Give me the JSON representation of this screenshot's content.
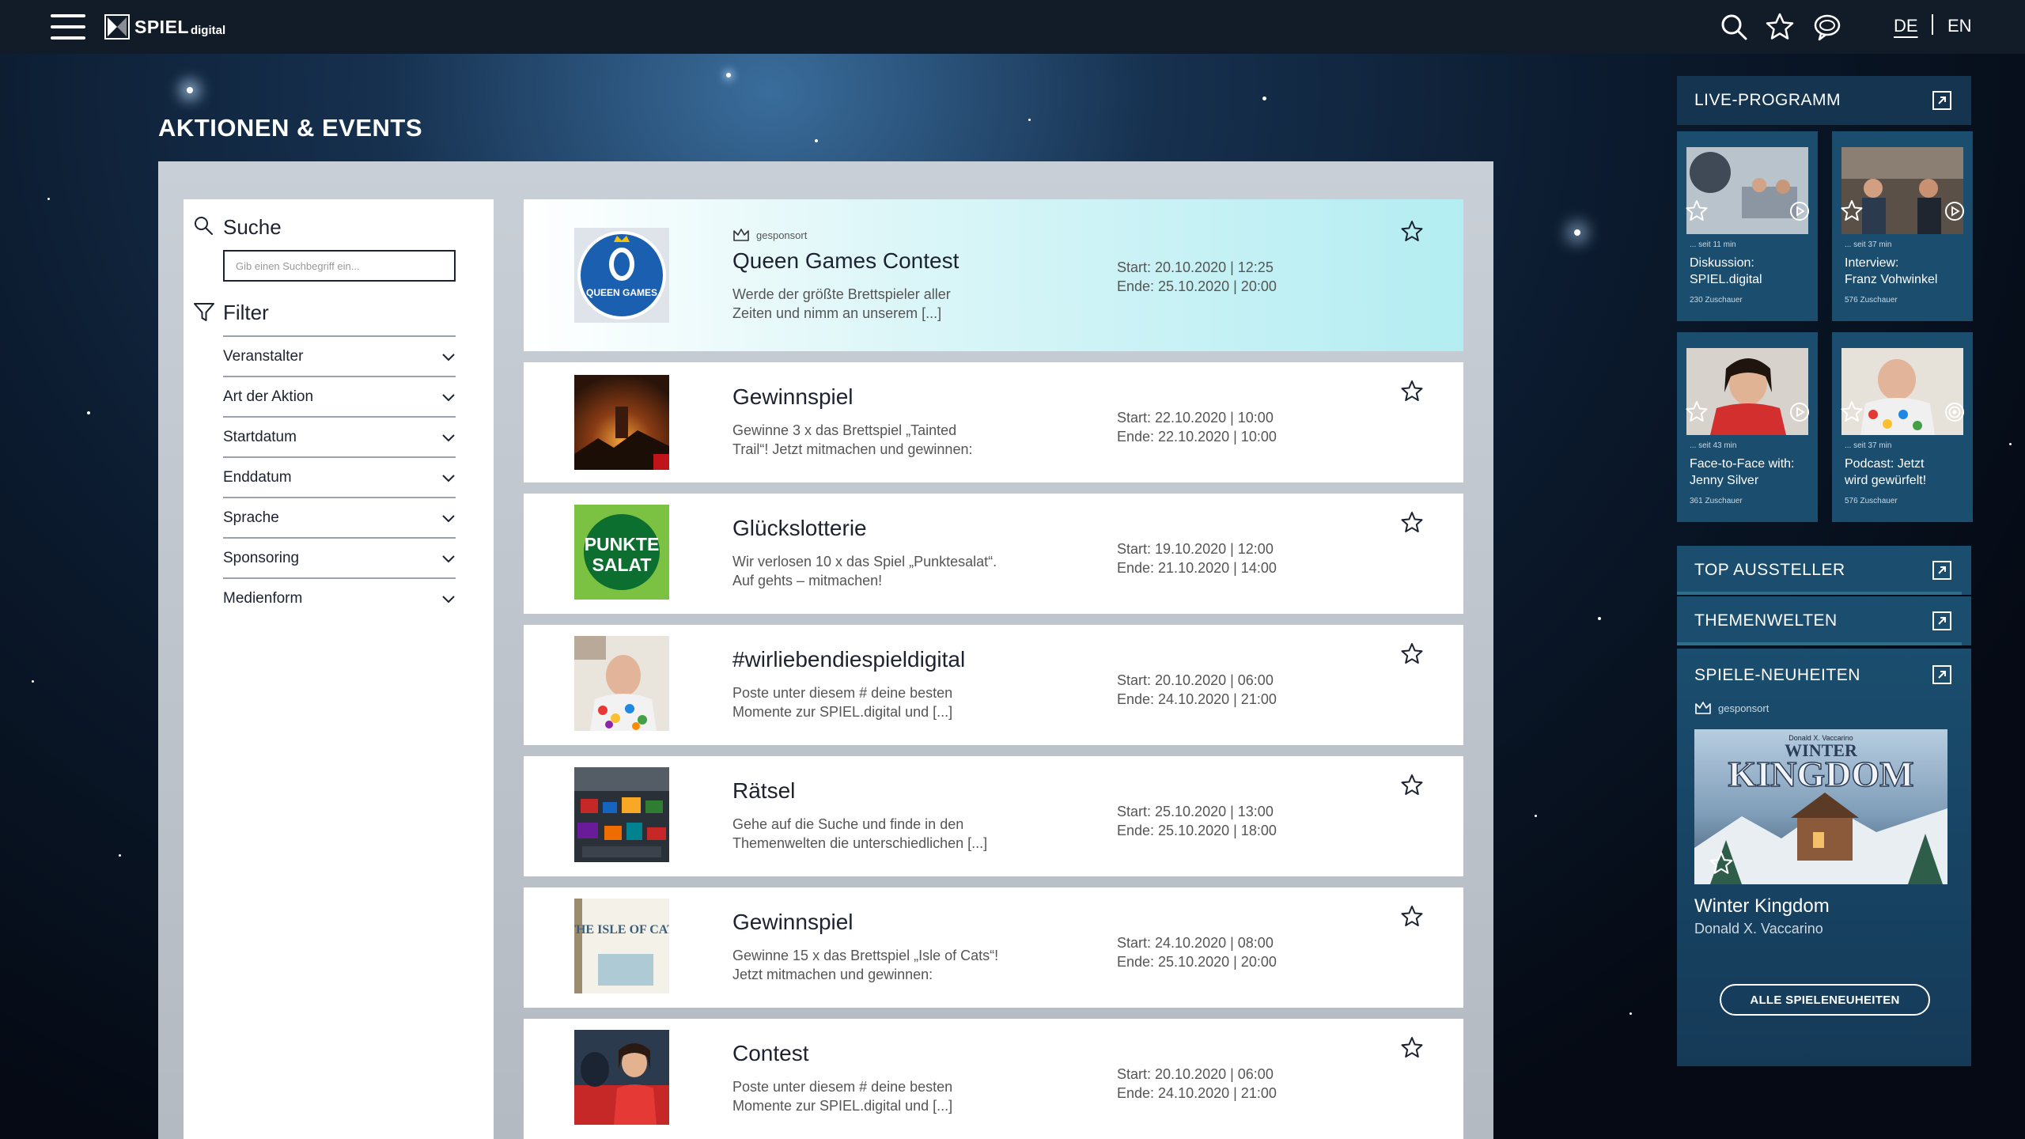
{
  "header": {
    "logo_main": "SPIEL",
    "logo_sub": "digital",
    "icons": [
      "menu-icon",
      "search-icon",
      "star-icon",
      "chat-icon"
    ],
    "lang_de": "DE",
    "lang_en": "EN"
  },
  "page": {
    "title": "AKTIONEN & EVENTS"
  },
  "filter": {
    "search_title": "Suche",
    "search_placeholder": "Gib einen Suchbegriff ein...",
    "filter_title": "Filter",
    "items": [
      {
        "label": "Veranstalter"
      },
      {
        "label": "Art der Aktion"
      },
      {
        "label": "Startdatum"
      },
      {
        "label": "Enddatum"
      },
      {
        "label": "Sprache"
      },
      {
        "label": "Sponsoring"
      },
      {
        "label": "Medienform"
      }
    ]
  },
  "events": [
    {
      "badge": "gesponsort",
      "title": "Queen Games Contest",
      "desc1": "Werde der größte Brettspieler aller",
      "desc2": "Zeiten und nimm an unserem [...]",
      "start": "Start: 20.10.2020 | 12:25",
      "end": "Ende: 25.10.2020 | 20:00",
      "thumb_text": "QUEEN GAMES"
    },
    {
      "title": "Gewinnspiel",
      "desc1": "Gewinne 3 x das Brettspiel „Tainted",
      "desc2": "Trail“! Jetzt mitmachen und gewinnen:",
      "start": "Start: 22.10.2020 | 10:00",
      "end": "Ende: 22.10.2020 | 10:00"
    },
    {
      "title": "Glückslotterie",
      "desc1": "Wir verlosen 10 x das Spiel „Punktesalat“.",
      "desc2": "Auf gehts – mitmachen!",
      "start": "Start: 19.10.2020 | 12:00",
      "end": "Ende: 21.10.2020 | 14:00",
      "thumb_text1": "PUNKTE",
      "thumb_text2": "SALAT"
    },
    {
      "title": "#wirliebendiespieldigital",
      "desc1": "Poste unter diesem # deine besten",
      "desc2": "Momente zur SPIEL.digital und [...]",
      "start": "Start: 20.10.2020 | 06:00",
      "end": "Ende: 24.10.2020 | 21:00"
    },
    {
      "title": "Rätsel",
      "desc1": "Gehe auf die Suche und finde in den",
      "desc2": "Themenwelten die unterschiedlichen [...]",
      "start": "Start: 25.10.2020 | 13:00",
      "end": "Ende: 25.10.2020 | 18:00"
    },
    {
      "title": "Gewinnspiel",
      "desc1": "Gewinne 15 x das Brettspiel „Isle of Cats“!",
      "desc2": "Jetzt mitmachen und gewinnen:",
      "start": "Start: 24.10.2020 | 08:00",
      "end": "Ende: 25.10.2020 | 20:00",
      "thumb_text": "THE ISLE OF CATS"
    },
    {
      "title": "Contest",
      "desc1": "Poste unter diesem # deine besten",
      "desc2": "Momente zur SPIEL.digital und [...]",
      "start": "Start: 20.10.2020 | 06:00",
      "end": "Ende: 24.10.2020 | 21:00"
    }
  ],
  "sidebar": {
    "live_title": "LIVE-PROGRAMM",
    "live": [
      {
        "meta": "... seit 11 min",
        "title1": "Diskussion:",
        "title2": "SPIEL.digital",
        "viewers": "230 Zuschauer"
      },
      {
        "meta": "... seit 37 min",
        "title1": "Interview:",
        "title2": "Franz Vohwinkel",
        "viewers": "576 Zuschauer"
      },
      {
        "meta": "... seit 43 min",
        "title1": "Face-to-Face with:",
        "title2": "Jenny Silver",
        "viewers": "361 Zuschauer"
      },
      {
        "meta": "... seit 37 min",
        "title1": "Podcast: Jetzt",
        "title2": "wird gewürfelt!",
        "viewers": "576 Zuschauer"
      }
    ],
    "top_aussteller": "TOP AUSSTELLER",
    "themenwelten": "THEMENWELTEN",
    "neuheiten_title": "SPIELE-NEUHEITEN",
    "neuheiten_badge": "gesponsort",
    "cover_pre": "Donald X. Vaccarino",
    "cover_line1": "WINTER",
    "cover_line2": "KINGDOM",
    "game_title": "Winter Kingdom",
    "game_author": "Donald X. Vaccarino",
    "all_button": "ALLE SPIELENEUHEITEN"
  }
}
